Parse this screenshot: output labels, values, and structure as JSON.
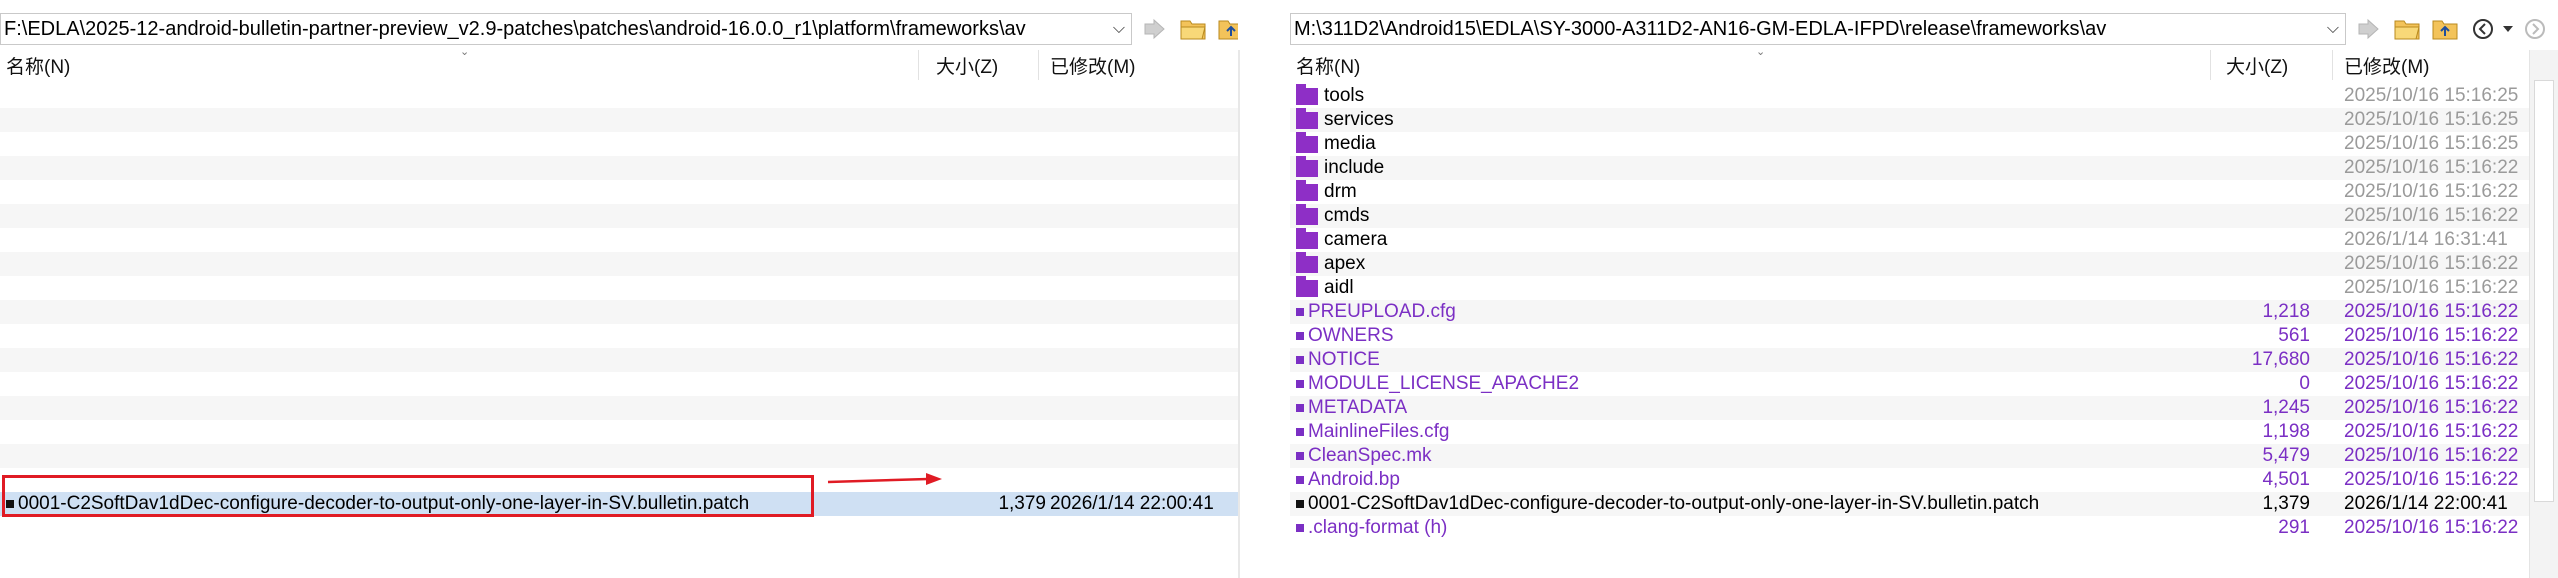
{
  "left": {
    "path": "F:\\EDLA\\2025-12-android-bulletin-partner-preview_v2.9-patches\\patches\\android-16.0.0_r1\\platform\\frameworks\\av",
    "columns": {
      "name": "名称(N)",
      "size": "大小(Z)",
      "modified": "已修改(M)"
    },
    "file": {
      "name": "0001-C2SoftDav1dDec-configure-decoder-to-output-only-one-layer-in-SV.bulletin.patch",
      "size": "1,379",
      "modified": "2026/1/14 22:00:41"
    }
  },
  "right": {
    "path": "M:\\311D2\\Android15\\EDLA\\SY-3000-A311D2-AN16-GM-EDLA-IFPD\\release\\frameworks\\av",
    "columns": {
      "name": "名称(N)",
      "size": "大小(Z)",
      "modified": "已修改(M)"
    },
    "rows": [
      {
        "name": "tools",
        "type": "folder",
        "size": "",
        "modified": "2025/10/16 15:16:25"
      },
      {
        "name": "services",
        "type": "folder",
        "size": "",
        "modified": "2025/10/16 15:16:25"
      },
      {
        "name": "media",
        "type": "folder",
        "size": "",
        "modified": "2025/10/16 15:16:25"
      },
      {
        "name": "include",
        "type": "folder",
        "size": "",
        "modified": "2025/10/16 15:16:22"
      },
      {
        "name": "drm",
        "type": "folder",
        "size": "",
        "modified": "2025/10/16 15:16:22"
      },
      {
        "name": "cmds",
        "type": "folder",
        "size": "",
        "modified": "2025/10/16 15:16:22"
      },
      {
        "name": "camera",
        "type": "folder",
        "size": "",
        "modified": "2026/1/14 16:31:41"
      },
      {
        "name": "apex",
        "type": "folder",
        "size": "",
        "modified": "2025/10/16 15:16:22"
      },
      {
        "name": "aidl",
        "type": "folder",
        "size": "",
        "modified": "2025/10/16 15:16:22"
      },
      {
        "name": "PREUPLOAD.cfg",
        "type": "file",
        "size": "1,218",
        "modified": "2025/10/16 15:16:22"
      },
      {
        "name": "OWNERS",
        "type": "file",
        "size": "561",
        "modified": "2025/10/16 15:16:22"
      },
      {
        "name": "NOTICE",
        "type": "file",
        "size": "17,680",
        "modified": "2025/10/16 15:16:22"
      },
      {
        "name": "MODULE_LICENSE_APACHE2",
        "type": "file",
        "size": "0",
        "modified": "2025/10/16 15:16:22"
      },
      {
        "name": "METADATA",
        "type": "file",
        "size": "1,245",
        "modified": "2025/10/16 15:16:22"
      },
      {
        "name": "MainlineFiles.cfg",
        "type": "file",
        "size": "1,198",
        "modified": "2025/10/16 15:16:22"
      },
      {
        "name": "CleanSpec.mk",
        "type": "file",
        "size": "5,479",
        "modified": "2025/10/16 15:16:22"
      },
      {
        "name": "Android.bp",
        "type": "file",
        "size": "4,501",
        "modified": "2025/10/16 15:16:22"
      },
      {
        "name": "0001-C2SoftDav1dDec-configure-decoder-to-output-only-one-layer-in-SV.bulletin.patch",
        "type": "new-file",
        "size": "1,379",
        "modified": "2026/1/14 22:00:41"
      },
      {
        "name": ".clang-format (h)",
        "type": "file",
        "size": "291",
        "modified": "2025/10/16 15:16:22"
      }
    ]
  },
  "icons": {
    "left_toolbar": [
      "copy-right-icon",
      "open-folder-icon",
      "parent-folder-icon",
      "swap-panes-icon"
    ],
    "right_toolbar": [
      "copy-left-icon",
      "open-folder-icon",
      "parent-folder-icon",
      "back-icon",
      "dropdown-icon",
      "forward-icon"
    ]
  },
  "colors": {
    "folder": "#8e2fc6",
    "orphan_file": "#7b2fc4",
    "identical_file": "#9a9a9a",
    "selection": "#cfe0f3",
    "annotation": "#e01b24"
  }
}
